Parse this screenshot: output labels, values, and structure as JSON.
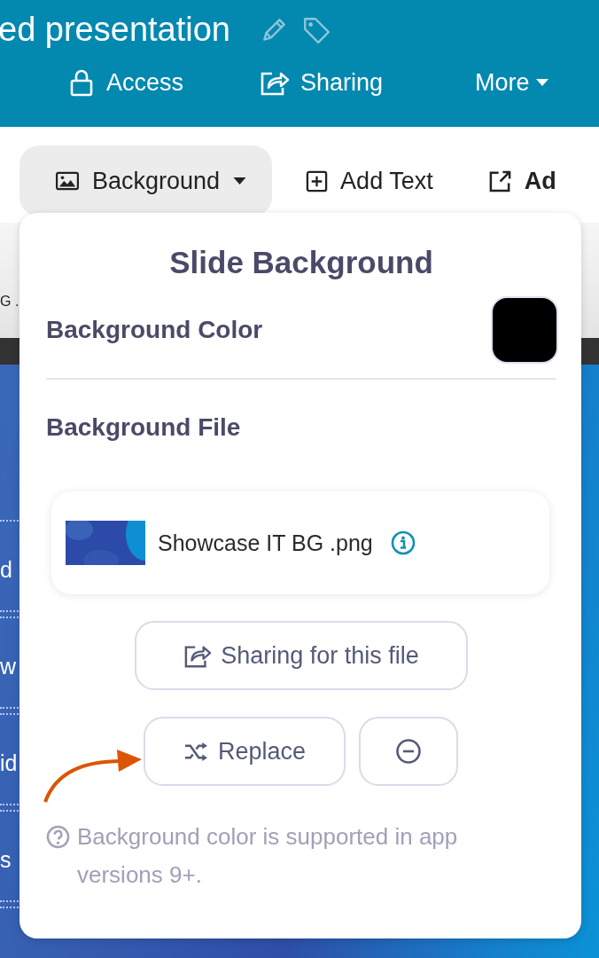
{
  "header": {
    "title": "ed presentation"
  },
  "nav": [
    {
      "label": "Access",
      "kind": "lock"
    },
    {
      "label": "Sharing",
      "kind": "share"
    },
    {
      "label": "More",
      "kind": "menu"
    }
  ],
  "toolbar": [
    {
      "label": "Background",
      "kind": "dropdown",
      "selected": true
    },
    {
      "label": "Add Text",
      "kind": "add",
      "selected": false
    },
    {
      "label": "Ad",
      "kind": "external",
      "selected": false
    }
  ],
  "behind": {
    "file_row": "G .",
    "slide_fragments": [
      "d",
      "w",
      "id",
      "s"
    ]
  },
  "popover": {
    "title": "Slide Background",
    "color_label": "Background Color",
    "color": "#000000",
    "file_label": "Background File",
    "file_name": "Showcase IT BG .png",
    "sharing_button": "Sharing for this file",
    "replace_button": "Replace",
    "note": "Background color is supported in app versions 9+."
  }
}
